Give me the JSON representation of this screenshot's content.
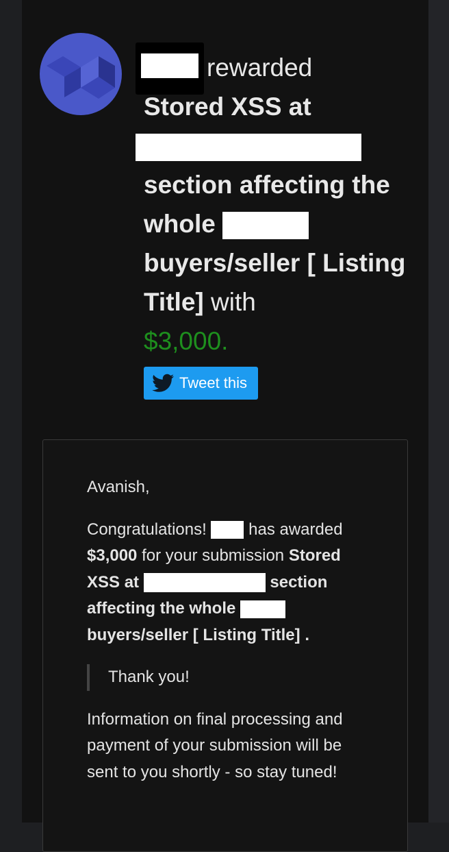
{
  "notification": {
    "rewarded_word": "rewarded",
    "title_part1": "Stored XSS at",
    "title_part2": "section affecting the whole",
    "title_part3": "buyers/seller [ Listing Title]",
    "with_word": "with",
    "amount": "$3,000."
  },
  "tweet_button": {
    "label": "Tweet this",
    "icon": "twitter-bird-icon"
  },
  "email": {
    "greeting": "Avanish,",
    "congrats": "Congratulations!",
    "has_awarded": "has awarded",
    "amount": "$3,000",
    "for_submission": "for your submission",
    "title_part1": "Stored XSS at",
    "title_part2": "section affecting the whole",
    "title_part3": "buyers/seller [ Listing Title]",
    "period": ".",
    "quote": "Thank you!",
    "closing": "Information on final processing and payment of your submission will be sent to you shortly - so stay tuned!"
  },
  "colors": {
    "amount_green": "#1e8f1e",
    "tweet_blue": "#1d9bf0",
    "avatar_blue": "#4a58c9"
  }
}
